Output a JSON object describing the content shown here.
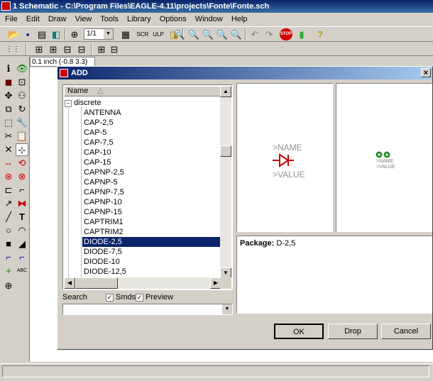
{
  "window": {
    "title": "1 Schematic - C:\\Program Files\\EAGLE-4.11\\projects\\Fonte\\Fonte.sch"
  },
  "menu": [
    "File",
    "Edit",
    "Draw",
    "View",
    "Tools",
    "Library",
    "Options",
    "Window",
    "Help"
  ],
  "toolbar": {
    "zoom_value": "1/1",
    "stop_label": "STOP",
    "help_label": "?"
  },
  "coord_readout": "0.1 inch (-0.8 3.3)",
  "dialog": {
    "title": "ADD",
    "close_label": "×",
    "tree": {
      "header": "Name",
      "root": "discrete",
      "items": [
        "ANTENNA",
        "CAP-2,5",
        "CAP-5",
        "CAP-7,5",
        "CAP-10",
        "CAP-15",
        "CAPNP-2,5",
        "CAPNP-5",
        "CAPNP-7,5",
        "CAPNP-10",
        "CAPNP-15",
        "CAPTRIM1",
        "CAPTRIM2",
        "DIODE-2,5",
        "DIODE-7,5",
        "DIODE-10",
        "DIODE-12,5"
      ],
      "selected": "DIODE-2,5"
    },
    "search_label": "Search",
    "smds_label": "Smds",
    "preview_label": "Preview",
    "search_value": "",
    "symbol_preview": {
      "name_text": ">NAME",
      "value_text": ">VALUE"
    },
    "package_preview": {
      "name_text": ">NAME",
      "value_text": ">VALUE"
    },
    "package_label": "Package:",
    "package_value": "D-2,5",
    "buttons": {
      "ok": "OK",
      "drop": "Drop",
      "cancel": "Cancel"
    },
    "colors": {
      "symbol": "#cc0000",
      "pads": "#2e8b2e",
      "text_gray": "#808080"
    }
  }
}
